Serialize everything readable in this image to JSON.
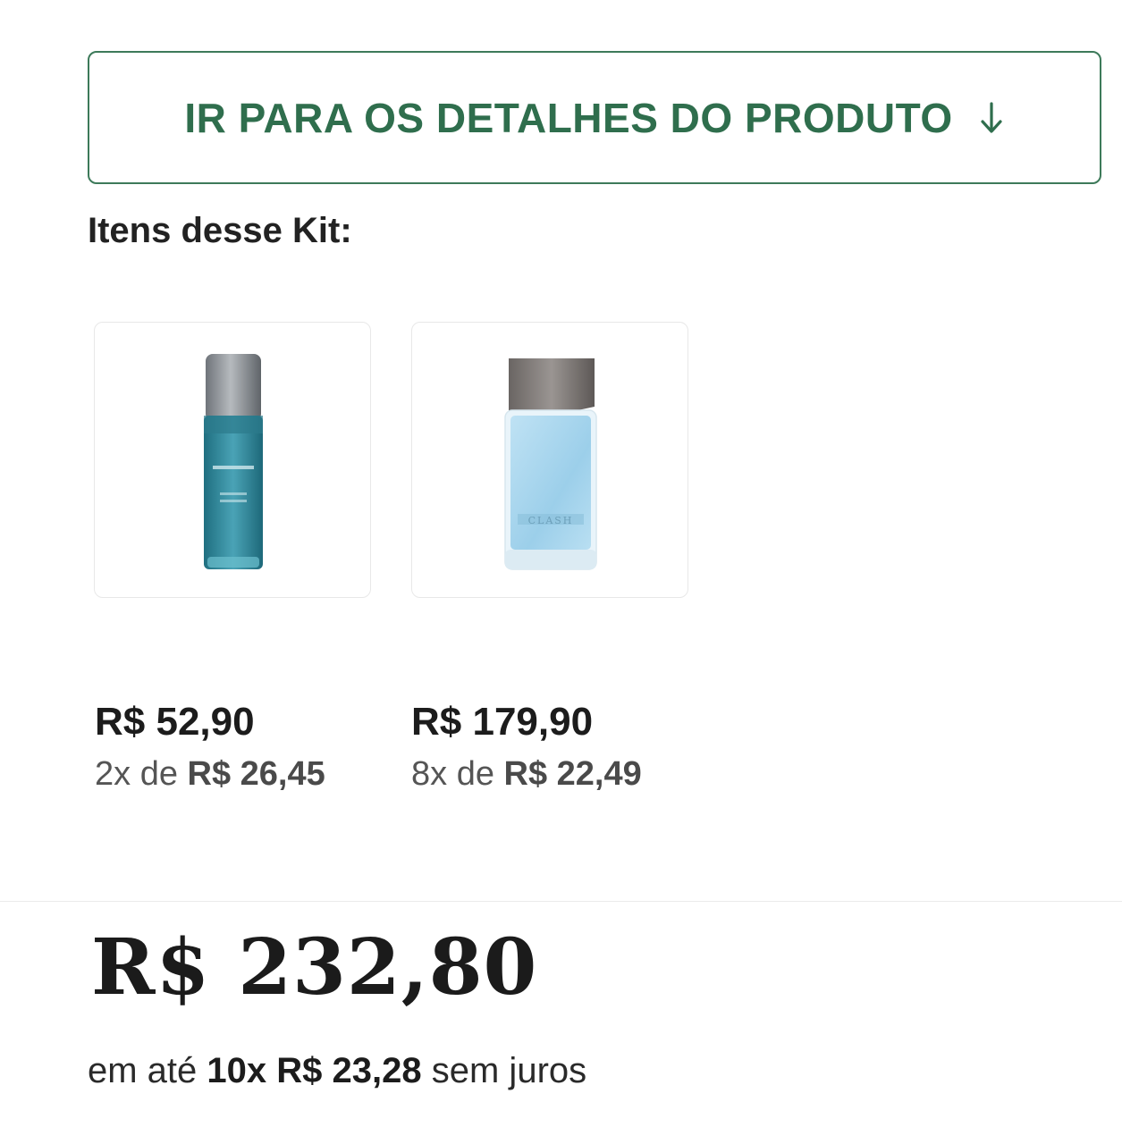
{
  "details_button": {
    "label": "IR PARA OS DETALHES DO PRODUTO",
    "icon": "arrow-down-icon",
    "color": "#2f6e4d"
  },
  "kit": {
    "title": "Itens desse Kit:"
  },
  "items": [
    {
      "image_icon": "body-spray-bottle-image",
      "price": "R$ 52,90",
      "installment_prefix": "2x de",
      "installment_value": "R$ 26,45"
    },
    {
      "image_icon": "perfume-bottle-image",
      "price": "R$ 179,90",
      "installment_prefix": "8x de",
      "installment_value": "R$ 22,49"
    }
  ],
  "total": {
    "price": "R$ 232,80",
    "installment_prefix": "em até",
    "installment_value": "10x R$ 23,28",
    "installment_suffix": "sem juros"
  }
}
